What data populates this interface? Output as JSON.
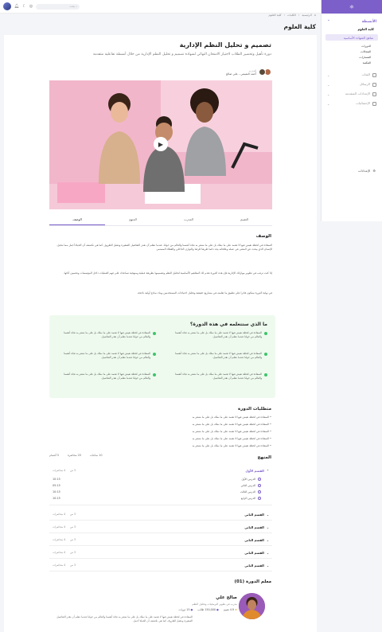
{
  "sidebar": {
    "brand": "⚛",
    "section_label": "الأنشطة",
    "group_title": "كلية العلوم",
    "active_item": "مناهج الشهادة الأساسية",
    "leaves": [
      "الدورات",
      "المجالات",
      "المسارات",
      "المكتبة"
    ],
    "rows": [
      "الفئات",
      "الرسائل",
      "الإعدادات المتقدمة",
      "الإحصائيات"
    ],
    "bottom_item": "الإعدادات"
  },
  "topbar": {
    "search_placeholder": "بحث"
  },
  "breadcrumb": [
    "الرئيسية",
    "الكليات",
    "كلية العلوم"
  ],
  "page_title": "كلية العلوم",
  "course": {
    "title": "تصميم و تحليل النظم الإدارية",
    "subtitle": "دورة تأهيل وتحضير الطلاب لاجتياز الامتحان النهائي لشهادة تصميم و تحليل النظم الإدارية من خلال أنشطة تفاعلية متقدمة",
    "instructor_label": "المدرب",
    "instructors": "أحمد التميمي ، علي صالح"
  },
  "tabs": [
    "الوصف",
    "المنهج",
    "المدرب",
    "التقييم"
  ],
  "description": {
    "heading": "الوصف",
    "p1": "السعادة في لحظة نعيش فيها لا تعتمد على ما نملك بل على ما نشعر به تجاه أنفسنا والعالم من حولنا. عندما نتعلم أن نقدر التفاصيل الصغيرة ونتقبل الظروف كما هي نكتشف أن الحياة أجمل مما نتخيل. الإنسان الذي يبحث عن المعنى في عمله وعلاقاته يجد دائما طريقا للرضا والتوازن الداخلي والعطاء المستمر.",
    "p2": "إذا كنت ترغب في تطوير مهاراتك الإدارية فإن هذه الدورة تقدم لك المفاهيم الأساسية لتحليل النظم وتصميمها بطريقة عملية ومنهجية تساعدك على فهم العمليات داخل المؤسسات وتحسين أدائها.",
    "p3": "في نهاية الدورة ستكون قادرا على تطبيق ما تعلمته في مشاريع حقيقية وتحليل احتياجات المستخدمين وبناء نماذج أولية ناجحة."
  },
  "learn": {
    "heading": "ما الذي ستتعلمه في هذه الدورة؟",
    "items": [
      "السعادة في لحظة نعيش فيها لا تعتمد على ما نملك بل على ما نشعر به تجاه أنفسنا والعالم من حولنا عندما نتعلم أن نقدر التفاصيل.",
      "السعادة في لحظة نعيش فيها لا تعتمد على ما نملك بل على ما نشعر به تجاه أنفسنا والعالم من حولنا عندما نتعلم أن نقدر التفاصيل.",
      "السعادة في لحظة نعيش فيها لا تعتمد على ما نملك بل على ما نشعر به تجاه أنفسنا والعالم من حولنا عندما نتعلم أن نقدر التفاصيل.",
      "السعادة في لحظة نعيش فيها لا تعتمد على ما نملك بل على ما نشعر به تجاه أنفسنا والعالم من حولنا عندما نتعلم أن نقدر التفاصيل.",
      "السعادة في لحظة نعيش فيها لا تعتمد على ما نملك بل على ما نشعر به تجاه أنفسنا والعالم من حولنا عندما نتعلم أن نقدر التفاصيل.",
      "السعادة في لحظة نعيش فيها لا تعتمد على ما نملك بل على ما نشعر به تجاه أنفسنا والعالم من حولنا عندما نتعلم أن نقدر التفاصيل."
    ]
  },
  "requirements": {
    "heading": "متطلبات الدورة",
    "items": [
      "• السعادة في لحظة نعيش فيها لا تعتمد على ما نملك بل على ما نشعر به",
      "• السعادة في لحظة نعيش فيها لا تعتمد على ما نملك بل على ما نشعر به",
      "• السعادة في لحظة نعيش فيها لا تعتمد على ما نملك بل على ما نشعر به",
      "• السعادة في لحظة نعيش فيها لا تعتمد على ما نملك بل على ما نشعر به",
      "• السعادة في لحظة نعيش فيها لا تعتمد على ما نملك بل على ما نشعر به"
    ]
  },
  "curriculum": {
    "heading": "المنهج",
    "meta": [
      "5 أقسام",
      "20 محاضرة",
      "10 ساعات"
    ],
    "first_section": "القسم الأول",
    "first_meta": [
      "4 محاضرات",
      "3 س"
    ],
    "lessons": [
      {
        "title": "الدرس الأول",
        "time": "10:15"
      },
      {
        "title": "الدرس الثاني",
        "time": "05:15"
      },
      {
        "title": "الدرس الثالث",
        "time": "10:15"
      },
      {
        "title": "الدرس الرابع",
        "time": "10:15"
      }
    ],
    "sections": [
      {
        "title": "القسم الثاني",
        "lectures": "4 محاضرات",
        "hours": "3 س"
      },
      {
        "title": "القسم الثاني",
        "lectures": "4 محاضرات",
        "hours": "3 س"
      },
      {
        "title": "القسم الثاني",
        "lectures": "4 محاضرات",
        "hours": "3 س"
      },
      {
        "title": "القسم الثاني",
        "lectures": "4 محاضرات",
        "hours": "3 س"
      },
      {
        "title": "القسم الثاني",
        "lectures": "4 محاضرات",
        "hours": "3 س"
      }
    ]
  },
  "instructor": {
    "heading": "معلم الدورة (01)",
    "name": "صالح علي",
    "role": "مدرب في تطوير البرمجيات وتحليل النظم",
    "rating": "4.9 تقييم",
    "students": "150,000 طالب",
    "courses": "15 دورات",
    "bio": "السعادة في لحظة نعيش فيها لا تعتمد على ما نملك بل على ما نشعر به تجاه أنفسنا والعالم من حولنا عندما نتعلم أن نقدر التفاصيل الصغيرة ونتقبل الظروف كما هي نكتشف أن الحياة أجمل."
  }
}
